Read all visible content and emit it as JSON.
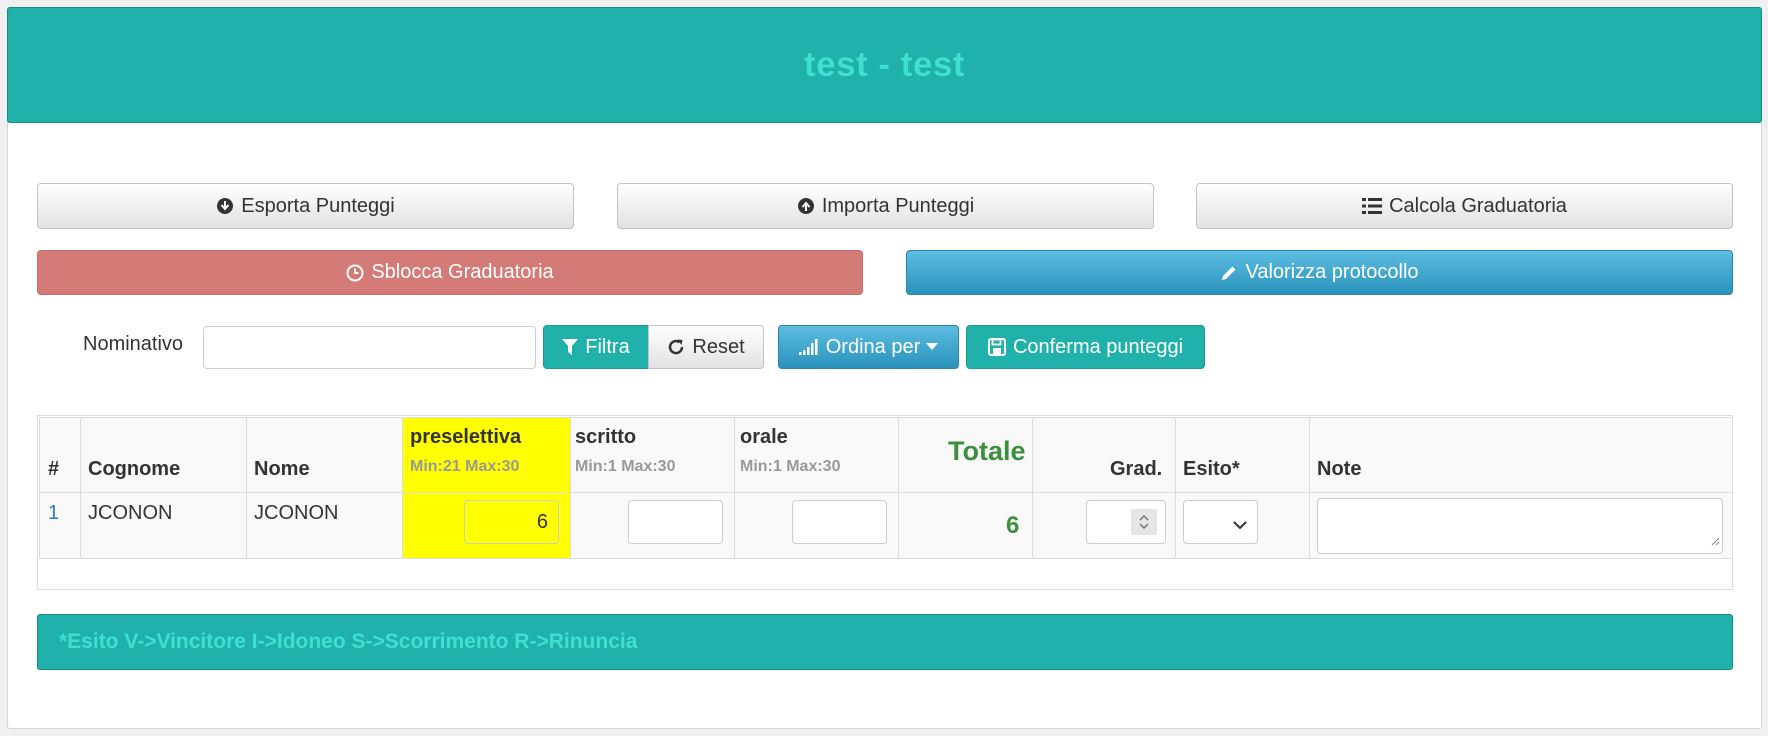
{
  "header": {
    "title": "test - test"
  },
  "actions": {
    "esporta": "Esporta Punteggi",
    "importa": "Importa Punteggi",
    "calcola": "Calcola Graduatoria",
    "sblocca": "Sblocca Graduatoria",
    "valorizza": "Valorizza protocollo"
  },
  "filter": {
    "label": "Nominativo",
    "value": "",
    "placeholder": "",
    "filtra": "Filtra",
    "reset": "Reset",
    "ordina": "Ordina per",
    "conferma": "Conferma punteggi"
  },
  "table": {
    "headers": {
      "index": "#",
      "cognome": "Cognome",
      "nome": "Nome",
      "preselettiva": "preselettiva",
      "preselettiva_range": "Min:21 Max:30",
      "scritto": "scritto",
      "scritto_range": "Min:1 Max:30",
      "orale": "orale",
      "orale_range": "Min:1 Max:30",
      "totale": "Totale",
      "grad": "Grad.",
      "esito": "Esito*",
      "note": "Note"
    },
    "rows": [
      {
        "index": "1",
        "cognome": "JCONON",
        "nome": "JCONON",
        "preselettiva": "6",
        "scritto": "",
        "orale": "",
        "totale": "6",
        "grad": "",
        "esito": "",
        "note": ""
      }
    ]
  },
  "legend": {
    "text": "*Esito V->Vincitore I->Idoneo S->Scorrimento R->Rinuncia"
  },
  "colors": {
    "teal": "#20b2aa",
    "turquoise_text": "#40e0d0",
    "danger": "#d47b77",
    "info": "#2b93bd",
    "highlight": "#ffff00",
    "total_green": "#3c8f3c"
  }
}
